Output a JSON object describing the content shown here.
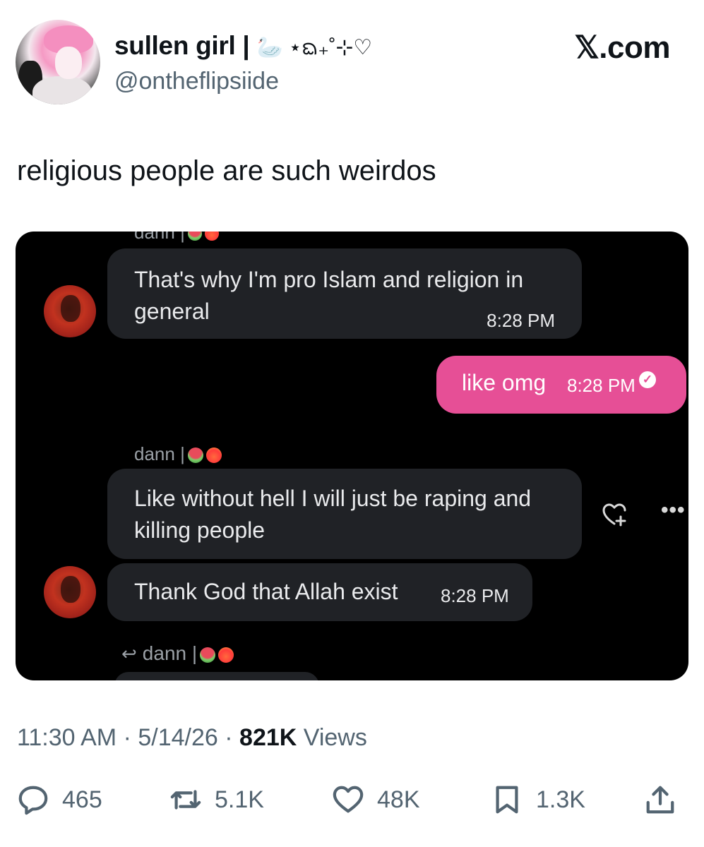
{
  "header": {
    "display_name": "sullen girl |",
    "name_decoration": "🦢 ⋆ᨳ₊˚⊹♡",
    "handle": "@ontheflipsiide",
    "brand": "𝕏.com"
  },
  "tweet": {
    "text": "religious people are such weirdos"
  },
  "chat": {
    "sender_top": "dann |",
    "messages": [
      {
        "text": "That's why I'm pro Islam and religion in general",
        "time": "8:28 PM"
      },
      {
        "text": "like omg",
        "time": "8:28 PM"
      },
      {
        "text": "Like without hell I will just be raping and killing people"
      },
      {
        "text": "Thank God that Allah exist",
        "time": "8:28 PM"
      }
    ],
    "sender_mid": "dann |",
    "sender_bottom": "dann |",
    "more_label": "•••"
  },
  "meta": {
    "time": "11:30 AM",
    "date": "5/14/26",
    "views_count": "821K",
    "views_label": "Views"
  },
  "actions": {
    "replies": "465",
    "reposts": "5.1K",
    "likes": "48K",
    "bookmarks": "1.3K"
  }
}
